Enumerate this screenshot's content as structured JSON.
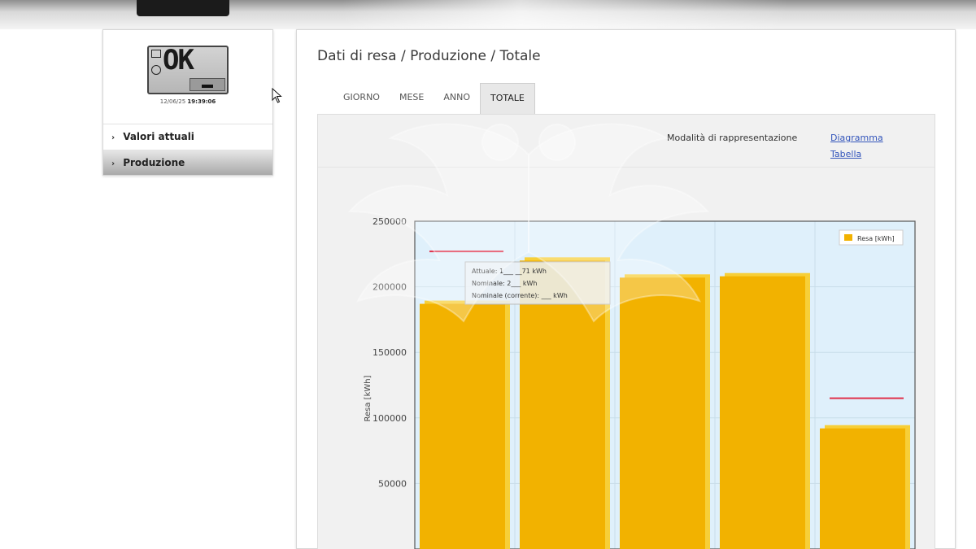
{
  "status": {
    "lcd_text": "OK",
    "date": "12/06/25",
    "time": "19:39:06"
  },
  "nav": {
    "items": [
      {
        "label": "Valori attuali"
      },
      {
        "label": "Produzione"
      }
    ]
  },
  "page_title": "Dati di resa / Produzione / Totale",
  "tabs": [
    {
      "label": "GIORNO"
    },
    {
      "label": "MESE"
    },
    {
      "label": "ANNO"
    },
    {
      "label": "TOTALE"
    }
  ],
  "mode": {
    "label": "Modalità di rappresentazione",
    "diagram_link": "Diagramma",
    "table_link": "Tabella"
  },
  "chart_data": {
    "type": "bar",
    "ylabel": "Resa [kWh]",
    "yticks": [
      "50000",
      "100000",
      "150000",
      "200000",
      "250000"
    ],
    "ylim": [
      0,
      250000
    ],
    "series": [
      {
        "name": "Resa [kWh]",
        "values": [
          187000,
          220000,
          207000,
          208000,
          92000
        ]
      }
    ],
    "nominal_markers": [
      227000,
      null,
      null,
      null,
      115000
    ],
    "grid": true,
    "legend": "top-right",
    "colors": {
      "bar": "#f2b200",
      "bar_side": "#f7cf38",
      "marker": "#e0304a",
      "plot_bg": "#dff0fb"
    },
    "tooltip": {
      "lines": [
        "Attuale: 1___ __71 kWh",
        "Nominale: 2___ kWh",
        "Nominale (corrente): ___ kWh"
      ]
    }
  }
}
